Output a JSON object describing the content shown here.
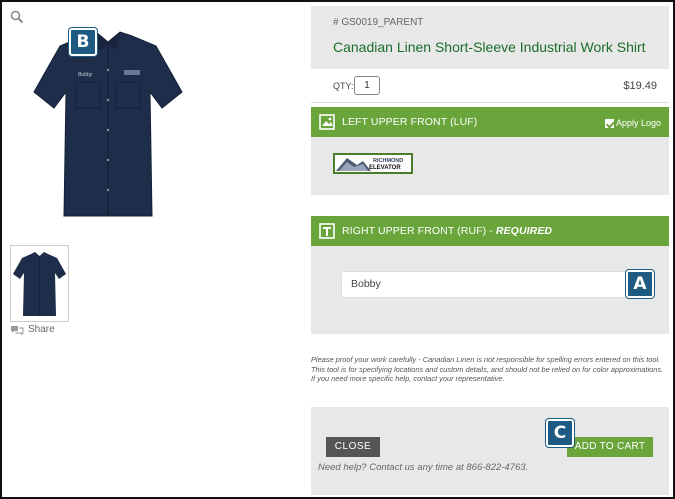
{
  "product": {
    "sku": "# GS0019_PARENT",
    "title": "Canadian Linen Short-Sleeve Industrial Work Shirt",
    "qty_label": "QTY:",
    "qty_value": "1",
    "price": "$19.49"
  },
  "gallery": {
    "share_label": "Share",
    "shirt_color": "#1e2d49"
  },
  "badges": {
    "b": "B",
    "a": "A",
    "c": "C"
  },
  "sections": {
    "luf": {
      "label": "LEFT UPPER FRONT (LUF)",
      "apply_logo_label": "Apply Logo",
      "apply_logo_checked": true,
      "logo_text_line1": "RICHMOND",
      "logo_text_line2": "ELEVATOR"
    },
    "ruf": {
      "label_prefix": "RIGHT UPPER FRONT (RUF) - ",
      "label_required": "REQUIRED",
      "text_value": "Bobby"
    }
  },
  "disclaimer": "Please proof your work carefully - Canadian Linen is not responsible for spelling errors entered on this tool. This tool is for specifying locations and custom details, and should not be relied on for color approximations. If you need more specific help, contact your representative.",
  "footer": {
    "close_label": "CLOSE",
    "add_to_cart_label": "ADD TO CART",
    "help_text": "Need help? Contact us any time at 866-822-4763."
  },
  "colors": {
    "accent_green": "#6aa53c",
    "title_green": "#1a6e2a",
    "badge_blue": "#1f5a82",
    "panel_gray": "#e8e8e8"
  }
}
